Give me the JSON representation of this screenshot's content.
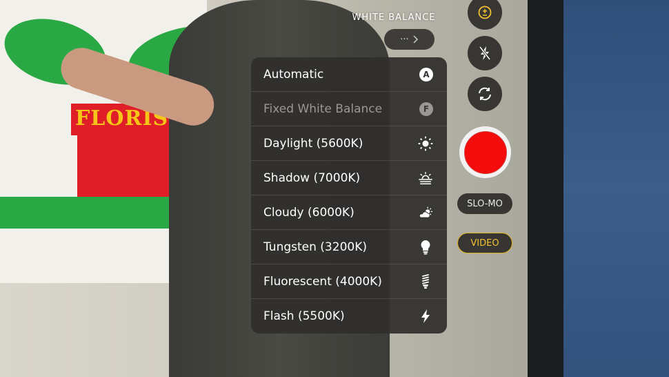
{
  "white_balance": {
    "label": "WHITE BALANCE",
    "more_button": "···",
    "options": [
      {
        "label": "Automatic",
        "icon": "A",
        "icon_name": "auto-badge-icon",
        "selected": true
      },
      {
        "label": "Fixed White Balance",
        "icon": "F",
        "icon_name": "fixed-badge-icon",
        "disabled": true
      },
      {
        "label": "Daylight (5600K)",
        "icon_name": "sun-icon"
      },
      {
        "label": "Shadow (7000K)",
        "icon_name": "sunset-icon"
      },
      {
        "label": "Cloudy (6000K)",
        "icon_name": "cloud-sun-icon"
      },
      {
        "label": "Tungsten (3200K)",
        "icon_name": "lightbulb-icon"
      },
      {
        "label": "Fluorescent (4000K)",
        "icon_name": "cfl-bulb-icon"
      },
      {
        "label": "Flash (5500K)",
        "icon_name": "bolt-icon"
      }
    ]
  },
  "controls": {
    "modes": [
      {
        "label": "SLO-MO",
        "active": false
      },
      {
        "label": "VIDEO",
        "active": true
      }
    ],
    "accent_color": "#f2c230",
    "record_color": "#f40b0b"
  },
  "poster_text": "FLORIST"
}
